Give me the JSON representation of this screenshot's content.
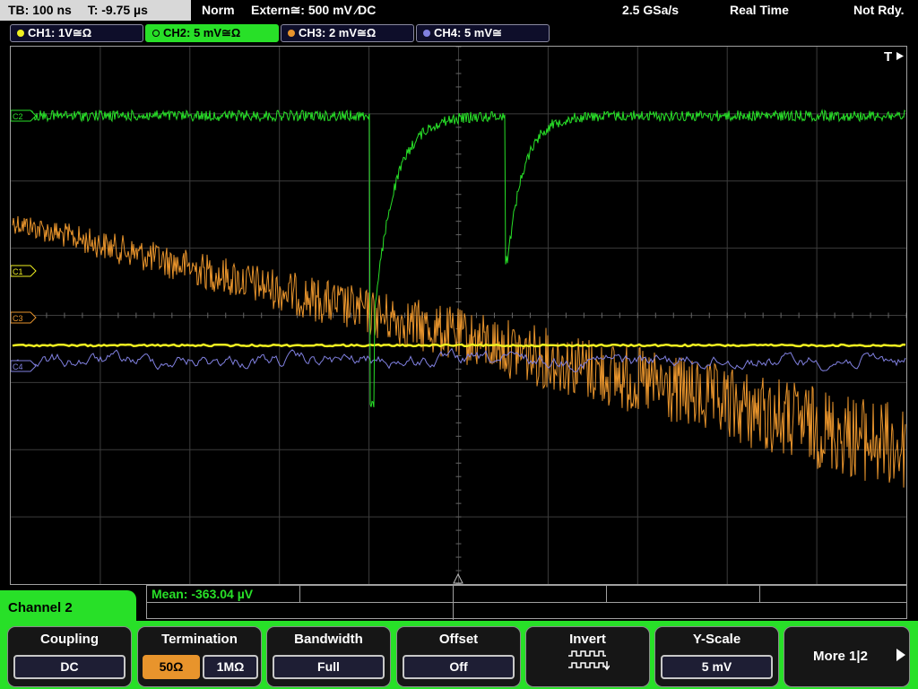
{
  "status": {
    "timebase": "TB: 100 ns",
    "trigger_time": "T: -9.75 µs",
    "mode": "Norm",
    "trigger_source": "Extern≅: 500 mV ∕DC",
    "sample_rate": "2.5 GSa/s",
    "acq_mode": "Real Time",
    "trigger_state": "Not Rdy."
  },
  "channels": [
    {
      "label": "CH1: 1V≅Ω",
      "color": "#f0f020"
    },
    {
      "label": "CH2: 5 mV≅Ω",
      "color": "#28e028",
      "active": true
    },
    {
      "label": "CH3: 2 mV≅Ω",
      "color": "#e8942c"
    },
    {
      "label": "CH4: 5 mV≅",
      "color": "#8080e0"
    }
  ],
  "screen": {
    "trigger_marker": "T",
    "markers": {
      "c1": "C1",
      "c2": "C2",
      "c3": "C3",
      "c4": "C4"
    }
  },
  "measurement": {
    "text": "Mean: -363.04 µV"
  },
  "menu": {
    "title": "Channel 2",
    "coupling": {
      "title": "Coupling",
      "value": "DC"
    },
    "termination": {
      "title": "Termination",
      "opt1": "50Ω",
      "opt2": "1MΩ",
      "selected": "50Ω"
    },
    "bandwidth": {
      "title": "Bandwidth",
      "value": "Full"
    },
    "offset": {
      "title": "Offset",
      "value": "Off"
    },
    "invert": {
      "title": "Invert",
      "icon": "invert-waveform-icon"
    },
    "yscale": {
      "title": "Y-Scale",
      "value": "5 mV"
    },
    "more": {
      "label": "More 1|2"
    }
  },
  "colors": {
    "ch1": "#f0f020",
    "ch2": "#28e028",
    "ch3": "#e8942c",
    "ch4": "#8080e0",
    "grid": "#3c3c3c"
  }
}
